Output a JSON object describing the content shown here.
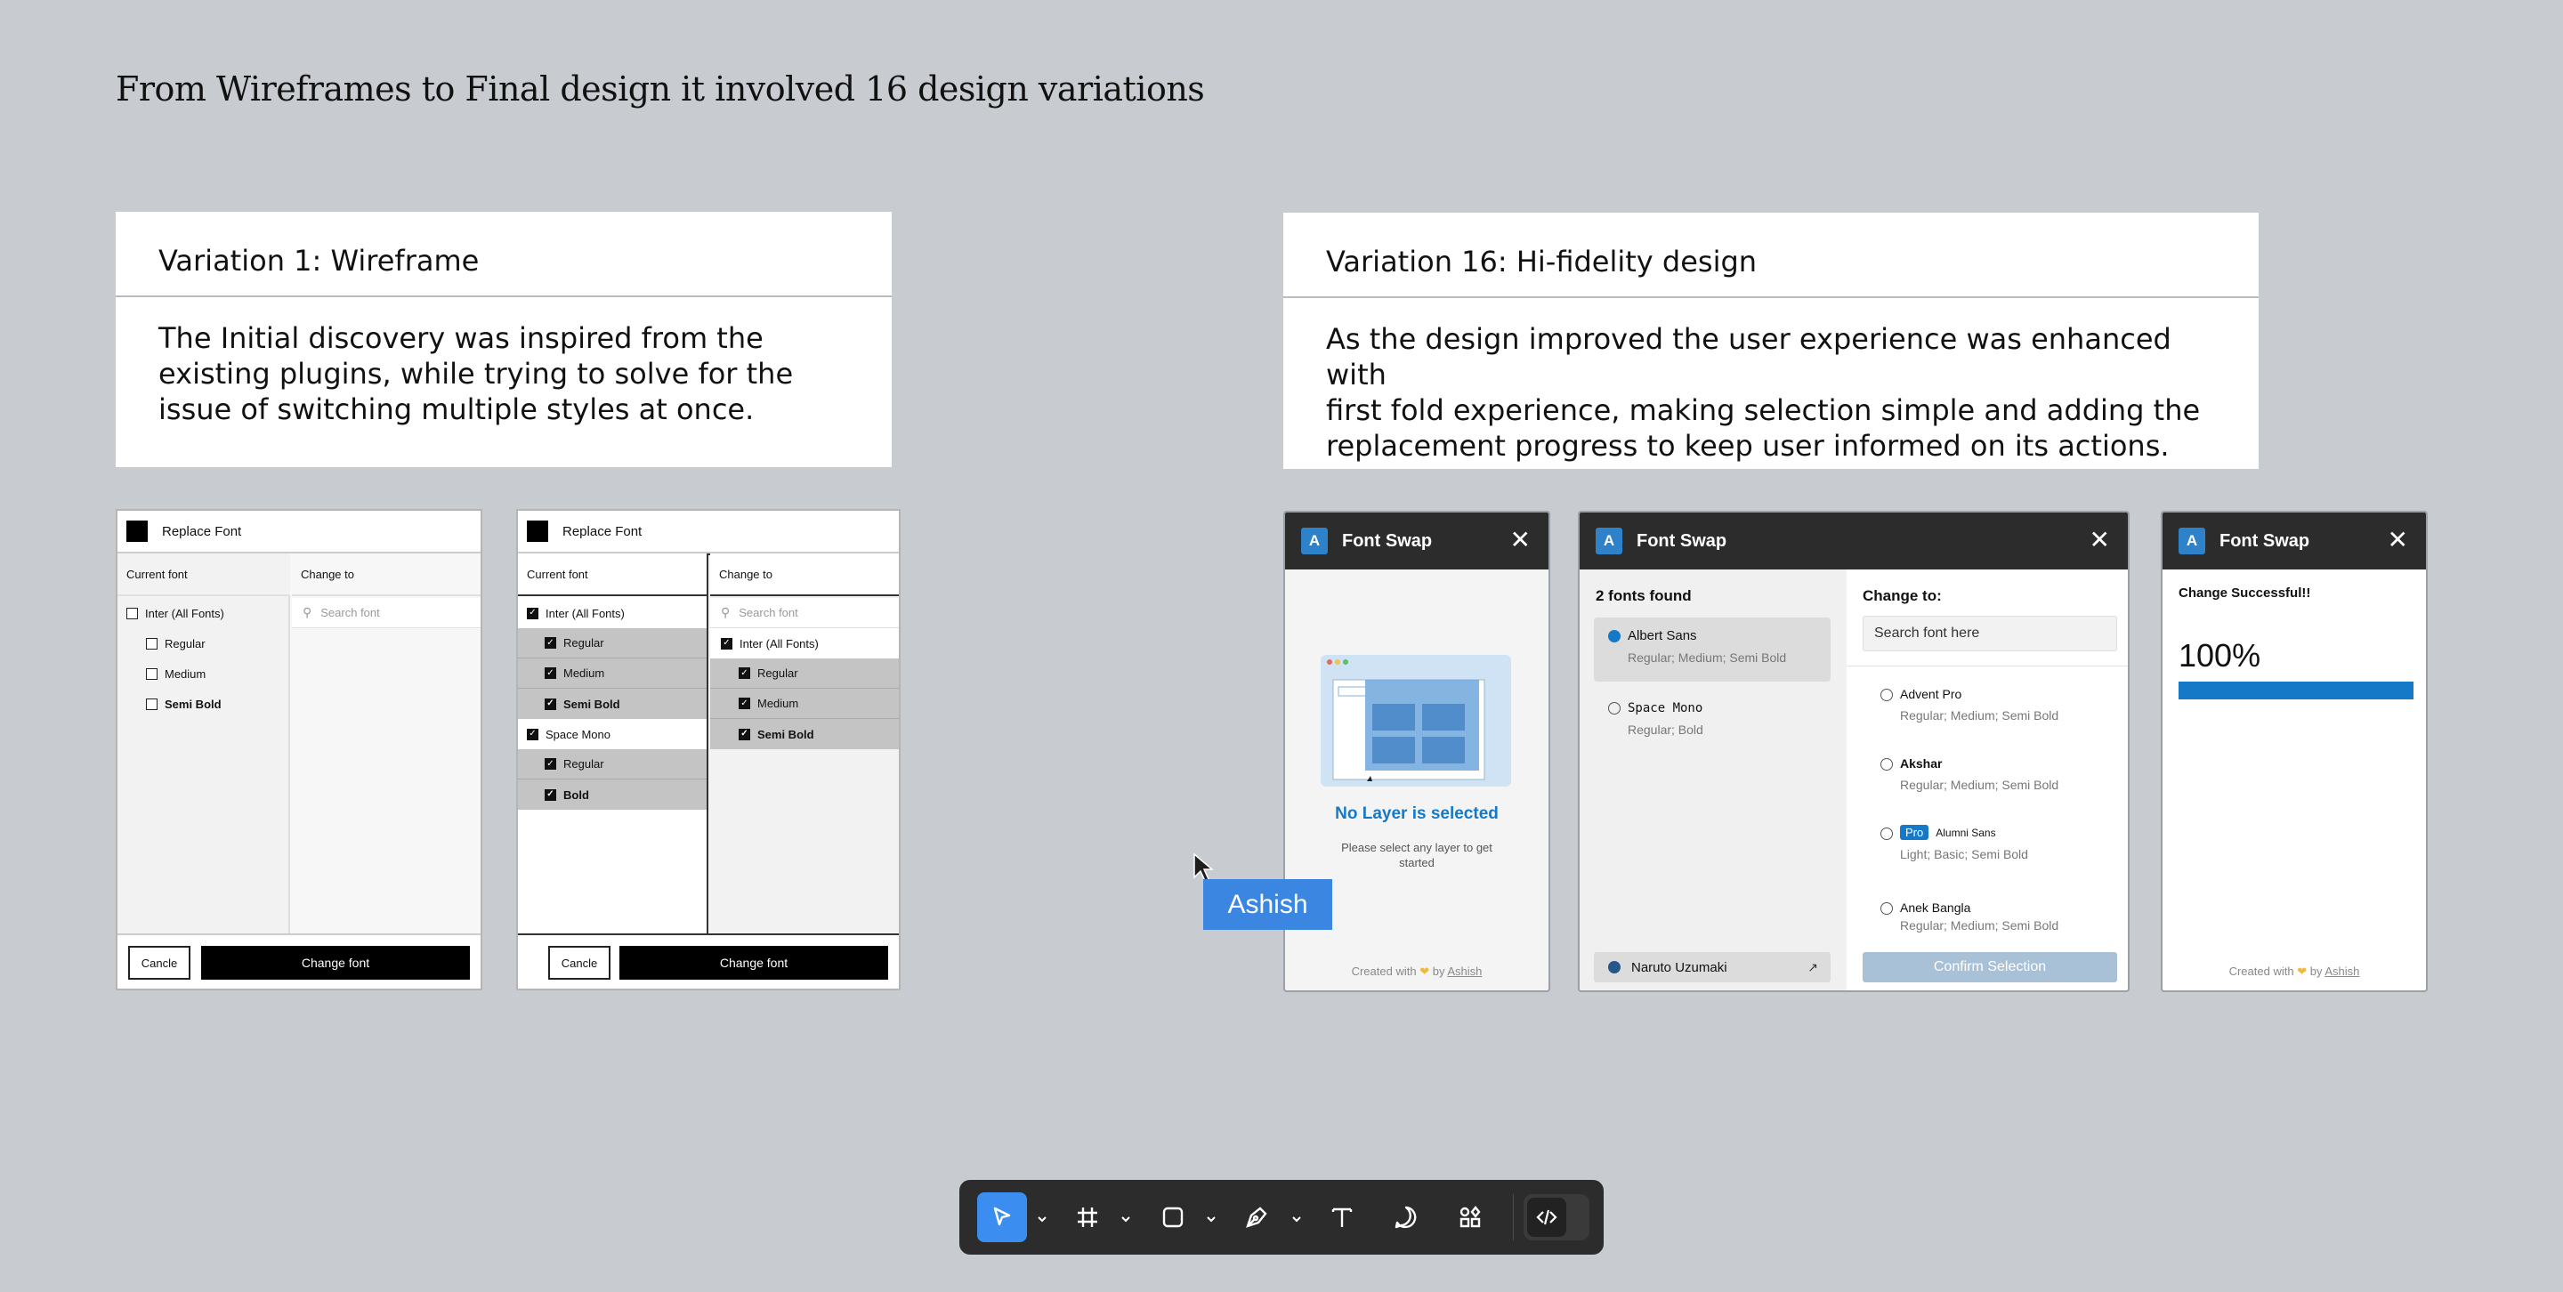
{
  "heading": "From Wireframes to Final design it involved 16 design variations",
  "card_left": {
    "title": "Variation 1: Wireframe",
    "desc_lines": [
      "The Initial discovery was inspired from the",
      "existing plugins, while trying to solve for the",
      "issue of switching multiple styles at once."
    ]
  },
  "card_right": {
    "title": "Variation 16: Hi-fidelity design",
    "desc_lines": [
      "As the design improved the user experience was enhanced with",
      "first fold experience, making selection simple and adding the",
      "replacement progress to keep user informed on its actions."
    ]
  },
  "wireframe1": {
    "title": "Replace Font",
    "col_current": "Current font",
    "col_change": "Change to",
    "search_placeholder": "Search font",
    "items": [
      "Inter (All Fonts)",
      "Regular",
      "Medium",
      "Semi Bold"
    ],
    "cancel": "Cancle",
    "primary": "Change font"
  },
  "wireframe2": {
    "title": "Replace Font",
    "col_current": "Current font",
    "col_change": "Change to",
    "search_placeholder": "Search font",
    "left_items": [
      "Inter (All Fonts)",
      "Regular",
      "Medium",
      "Semi Bold",
      "Space Mono",
      "Regular",
      "Bold"
    ],
    "right_items": [
      "Inter (All Fonts)",
      "Regular",
      "Medium",
      "Semi Bold"
    ],
    "cancel": "Cancle",
    "primary": "Change font"
  },
  "hifi_common": {
    "app_name": "Font Swap",
    "logo_letter": "A",
    "close": "✕"
  },
  "hifi1": {
    "empty_title": "No Layer is selected",
    "empty_desc_1": "Please select any layer to get",
    "empty_desc_2": "started",
    "created_with": "Created with",
    "created_by": "by",
    "author": "Ashish"
  },
  "hifi2": {
    "found_label": "2 fonts found",
    "found": [
      {
        "name": "Albert Sans",
        "styles": "Regular; Medium; Semi Bold"
      },
      {
        "name": "Space Mono",
        "styles": "Regular; Bold"
      }
    ],
    "change_to": "Change to:",
    "search_placeholder": "Search font here",
    "options": [
      {
        "name": "Advent Pro",
        "styles": "Regular; Medium; Semi Bold"
      },
      {
        "name": "Akshar",
        "styles": "Regular; Medium; Semi Bold"
      },
      {
        "badge": "Pro",
        "name": "Alumni Sans",
        "styles": "Light; Basic; Semi Bold"
      },
      {
        "name": "Anek Bangla",
        "styles": "Regular; Medium; Semi Bold"
      }
    ],
    "user": "Naruto Uzumaki",
    "confirm": "Confirm Selection"
  },
  "hifi3": {
    "status": "Change Successful!!",
    "percent": "100%",
    "progress": 1.0,
    "created_with": "Created with",
    "created_by": "by",
    "author": "Ashish"
  },
  "cursor_label": "Ashish",
  "colors": {
    "canvas": "#c8cbcf",
    "accent": "#3b8ef0",
    "brand_blue": "#1679c7",
    "toolbar": "#2c2c2c"
  },
  "toolbar": {
    "tools": [
      "move-tool",
      "frame-tool",
      "shape-tool",
      "pen-tool",
      "text-tool",
      "comment-tool",
      "actions-tool",
      "dev-mode-toggle"
    ],
    "selected": "move-tool"
  }
}
